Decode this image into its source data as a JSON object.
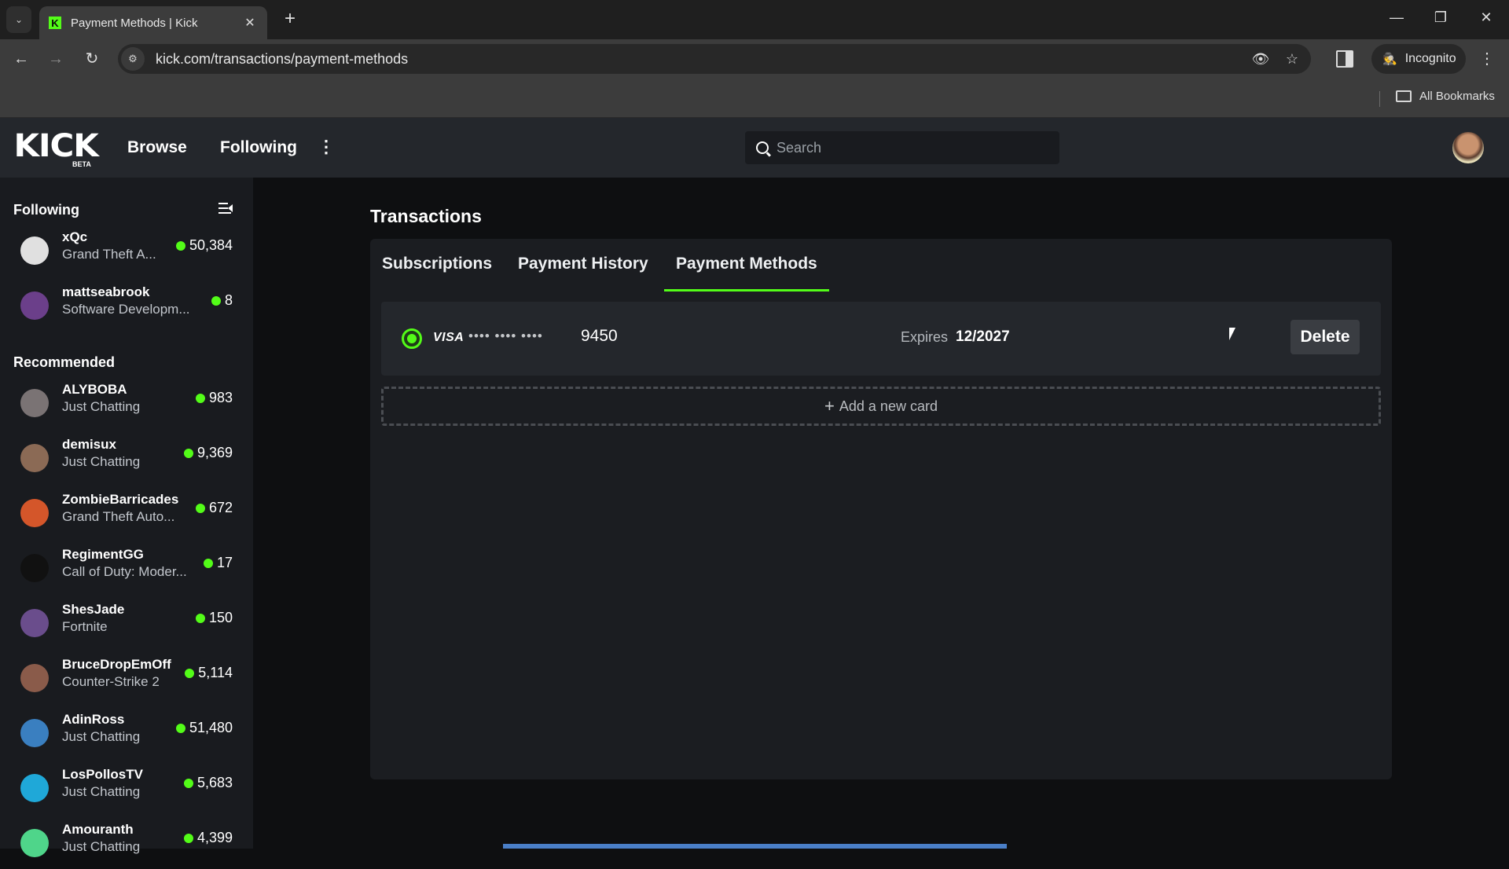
{
  "browser": {
    "tab_title": "Payment Methods | Kick",
    "url": "kick.com/transactions/payment-methods",
    "incognito_label": "Incognito",
    "all_bookmarks_label": "All Bookmarks",
    "icons": {
      "tab_search": "chevron-down-icon",
      "favicon": "K",
      "close": "✕",
      "new_tab": "+",
      "back": "←",
      "forward": "→",
      "reload": "↻",
      "site_info": "⚙",
      "eye_off": "👁",
      "star": "☆",
      "minimize": "—",
      "restore": "❐",
      "window_close": "✕",
      "menu": "⋮",
      "incognito": "🕵"
    }
  },
  "header": {
    "logo": "KICK",
    "beta": "BETA",
    "nav": [
      "Browse",
      "Following"
    ],
    "more": "⋮",
    "search_placeholder": "Search"
  },
  "sidebar": {
    "following_heading": "Following",
    "recommended_heading": "Recommended",
    "following": [
      {
        "name": "xQc",
        "category": "Grand Theft A...",
        "viewers": "50,384",
        "avatar_color": "#e0e0e0"
      },
      {
        "name": "mattseabrook",
        "category": "Software Developm...",
        "viewers": "8",
        "avatar_color": "#6b3f8a"
      }
    ],
    "recommended": [
      {
        "name": "ALYBOBA",
        "category": "Just Chatting",
        "viewers": "983",
        "avatar_color": "#7a7374"
      },
      {
        "name": "demisux",
        "category": "Just Chatting",
        "viewers": "9,369",
        "avatar_color": "#8b6a55"
      },
      {
        "name": "ZombieBarricades",
        "category": "Grand Theft Auto...",
        "viewers": "672",
        "avatar_color": "#d4562a"
      },
      {
        "name": "RegimentGG",
        "category": "Call of Duty: Moder...",
        "viewers": "17",
        "avatar_color": "#111111"
      },
      {
        "name": "ShesJade",
        "category": "Fortnite",
        "viewers": "150",
        "avatar_color": "#6a4d8c"
      },
      {
        "name": "BruceDropEmOff",
        "category": "Counter-Strike 2",
        "viewers": "5,114",
        "avatar_color": "#8a5b4a"
      },
      {
        "name": "AdinRoss",
        "category": "Just Chatting",
        "viewers": "51,480",
        "avatar_color": "#3a7fc0"
      },
      {
        "name": "LosPollosTV",
        "category": "Just Chatting",
        "viewers": "5,683",
        "avatar_color": "#1fa8d8"
      },
      {
        "name": "Amouranth",
        "category": "Just Chatting",
        "viewers": "4,399",
        "avatar_color": "#4fd58a"
      }
    ]
  },
  "main": {
    "title": "Transactions",
    "tabs": [
      {
        "label": "Subscriptions",
        "active": false
      },
      {
        "label": "Payment History",
        "active": false
      },
      {
        "label": "Payment Methods",
        "active": true
      }
    ],
    "card": {
      "brand": "VISA",
      "masked": "•••• •••• ••••",
      "last4": "9450",
      "expires_label": "Expires",
      "expires_value": "12/2027",
      "selected": true,
      "delete_label": "Delete"
    },
    "add_card_label": "Add a new card",
    "add_card_icon": "+"
  },
  "colors": {
    "accent": "#53fc18",
    "header_bg": "#24272c",
    "sidebar_bg": "#191b1f",
    "page_bg": "#0e0f11",
    "panel_bg": "#1b1d21"
  }
}
